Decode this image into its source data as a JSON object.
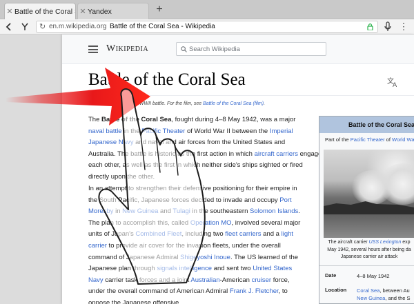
{
  "tabs": [
    {
      "label": "Battle of the Coral Sea",
      "active": true
    },
    {
      "label": "Yandex",
      "active": false
    }
  ],
  "new_tab_label": "+",
  "address": {
    "domain": "en.m.wikipedia.org",
    "title": "Battle of the Coral Sea - Wikipedia"
  },
  "wiki": {
    "logo": "Wikipedia",
    "search_placeholder": "Search Wikipedia",
    "title": "Battle of the Coral Sea",
    "hatnote": {
      "prefix": "This article is about the WWII battle. For the film, see",
      "link": "Battle of the Coral Sea (film)",
      "suffix": "."
    }
  },
  "article": {
    "para1": [
      "The Battle of the Coral Sea, fought during 4–8 May 1942, was a major",
      "naval battle in the Pacific Theater of World War II between the Imperial",
      "Japanese Navy and naval and air forces from the United States and",
      "Australia. The battle is historic as the first action in which aircraft carriers engaged",
      "each other, as well as the first in which neither side's ships sighted or fired",
      "directly upon the other."
    ],
    "para2": [
      "In an attempt to strengthen their defensive positioning for their empire in",
      "the South Pacific, Japanese forces decided to invade and occupy Port",
      "Moresby in New Guinea and Tulagi in the southeastern Solomon Islands.",
      "The plan to accomplish this, called Operation MO, involved several major",
      "units of Japan's Combined Fleet, including two fleet carriers and a light",
      "carrier to provide air cover for the invasion fleets, under the overall",
      "command of Japanese Admiral Shigeyoshi Inoue. The US learned of the",
      "Japanese plan through signals intelligence and sent two United States",
      "Navy carrier task forces and a joint Australian-American cruiser force,",
      "under the overall command of American Admiral Frank J. Fletcher, to",
      "oppose the Japanese offensive."
    ]
  },
  "infobox": {
    "title": "Battle of the Coral Sea",
    "subtitle": "Part of the Pacific Theater of World War II",
    "caption": [
      "The aircraft carrier USS Lexington exp",
      "May 1942, several hours after being da",
      "Japanese carrier air attack"
    ],
    "date_label": "Date",
    "date_value": "4–8 May 1942",
    "location_label": "Location",
    "location_value": [
      "Coral Sea, between Au",
      "New Guinea, and the S"
    ]
  },
  "colors": {
    "link": "#3366cc",
    "infobox_header": "#b0c4de",
    "arrow": "#e8181a"
  },
  "icons": {
    "back": "back-arrow-icon",
    "yandex": "yandex-icon",
    "lock": "lock-icon",
    "mic": "microphone-icon",
    "menu": "menu-icon",
    "language": "language-icon",
    "gesture": "swipe-left-hand-icon"
  }
}
